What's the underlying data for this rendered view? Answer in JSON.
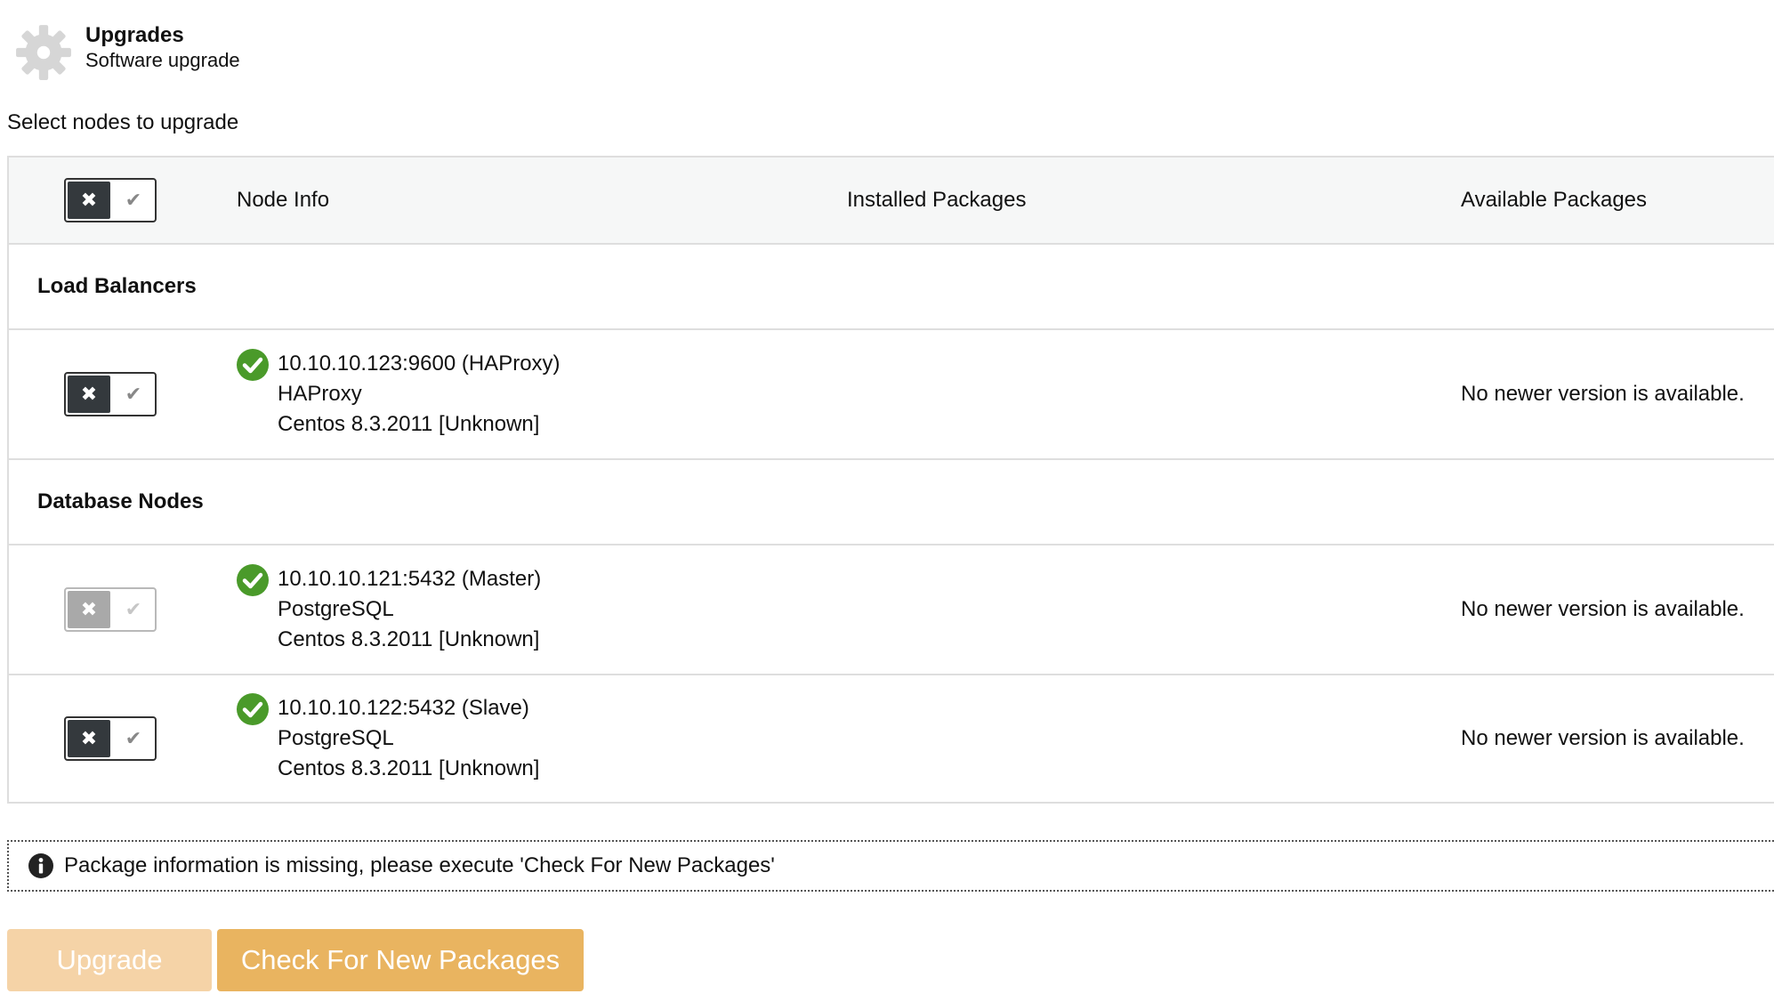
{
  "header": {
    "title": "Upgrades",
    "subtitle": "Software upgrade"
  },
  "select_label": "Select nodes to upgrade",
  "table": {
    "columns": [
      "Node Info",
      "Installed Packages",
      "Available Packages"
    ],
    "toggle": {
      "off_glyph": "✖",
      "on_glyph": "✔"
    },
    "groups": [
      {
        "label": "Load Balancers",
        "nodes": [
          {
            "address": "10.10.10.123:9600 (HAProxy)",
            "software": "HAProxy",
            "os": "Centos 8.3.2011 [Unknown]",
            "installed": "",
            "available": "No newer version is available.",
            "toggle_disabled": false
          }
        ]
      },
      {
        "label": "Database Nodes",
        "nodes": [
          {
            "address": "10.10.10.121:5432 (Master)",
            "software": "PostgreSQL",
            "os": "Centos 8.3.2011 [Unknown]",
            "installed": "",
            "available": "No newer version is available.",
            "toggle_disabled": true
          },
          {
            "address": "10.10.10.122:5432 (Slave)",
            "software": "PostgreSQL",
            "os": "Centos 8.3.2011 [Unknown]",
            "installed": "",
            "available": "No newer version is available.",
            "toggle_disabled": false
          }
        ]
      }
    ]
  },
  "info_message": "Package information is missing, please execute 'Check For New Packages'",
  "buttons": {
    "upgrade": "Upgrade",
    "check": "Check For New Packages"
  },
  "colors": {
    "success_green": "#4a9a2a",
    "toggle_dark": "#34393d",
    "upgrade_button": "#f5d3a7",
    "check_button": "#e9b460"
  },
  "icons": {
    "header": "gear-icon",
    "status": "check-circle-icon",
    "info": "info-circle-icon"
  }
}
